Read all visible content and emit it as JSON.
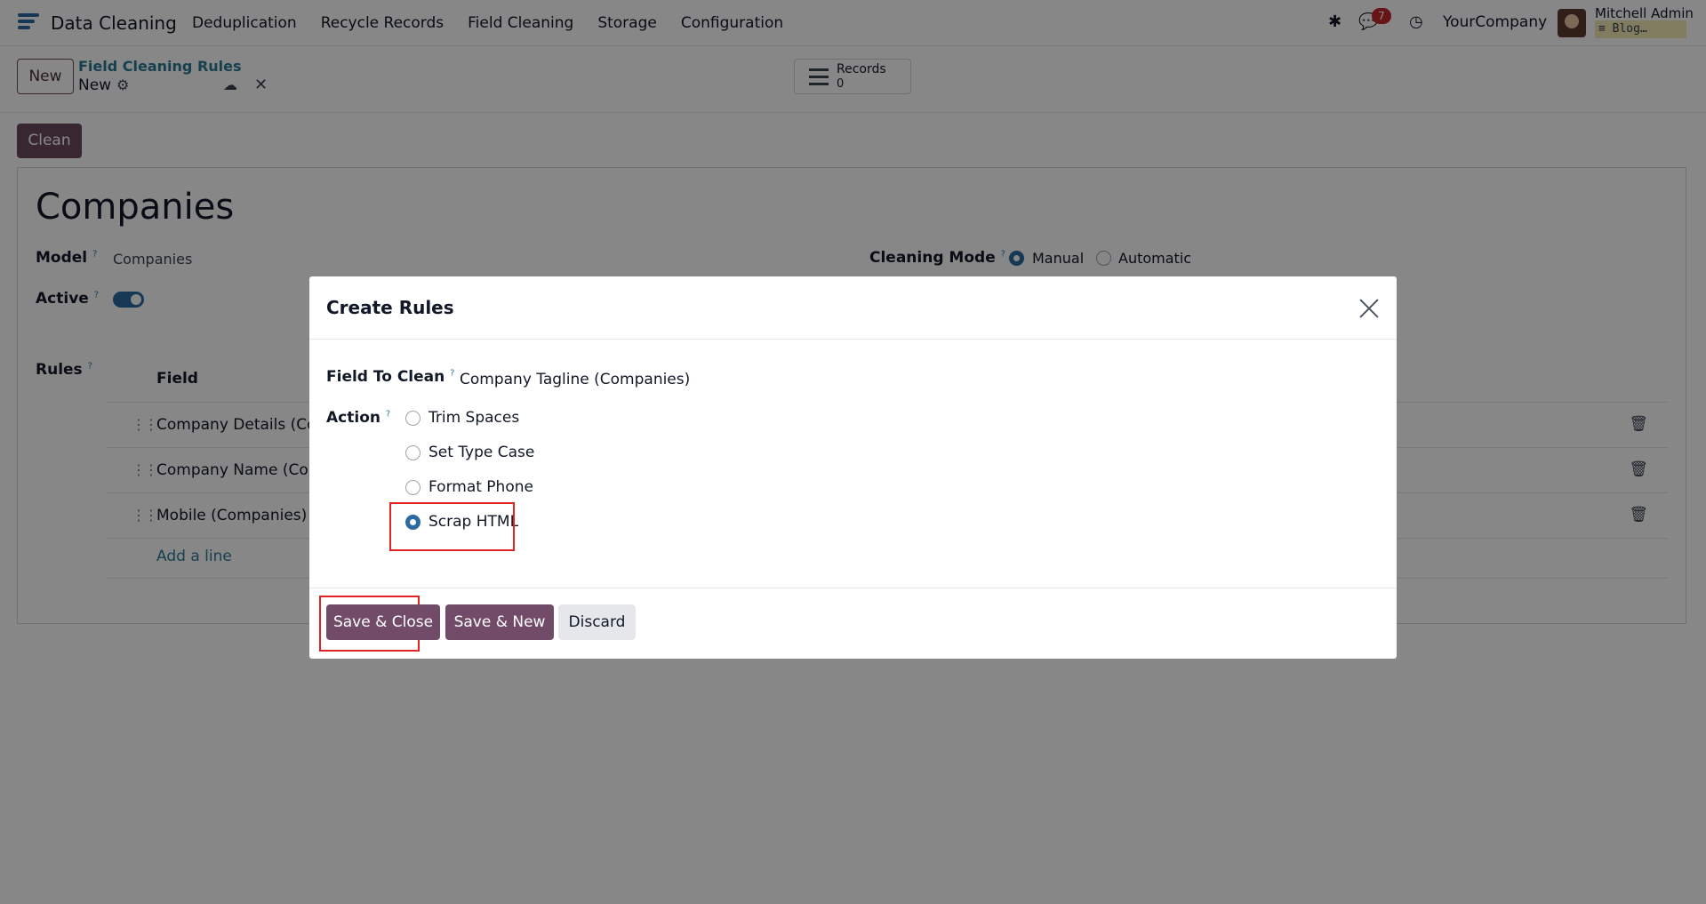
{
  "navbar": {
    "app_name": "Data Cleaning",
    "menu": [
      "Deduplication",
      "Recycle Records",
      "Field Cleaning",
      "Storage",
      "Configuration"
    ],
    "messages_count": "7",
    "company": "YourCompany",
    "user_name": "Mitchell Admin",
    "database": "Blog…"
  },
  "control_panel": {
    "new_label": "New",
    "breadcrumb_parent": "Field Cleaning Rules",
    "breadcrumb_current": "New",
    "records_label": "Records",
    "records_count": "0"
  },
  "form": {
    "clean_label": "Clean",
    "title": "Companies",
    "model_label": "Model",
    "model_value": "Companies",
    "active_label": "Active",
    "active": true,
    "cleaning_mode_label": "Cleaning Mode",
    "cleaning_modes": [
      "Manual",
      "Automatic"
    ],
    "cleaning_mode_selected": "Manual",
    "rules_label": "Rules",
    "rules_column": "Field",
    "rules": [
      "Company Details (Com",
      "Company Name (Comp",
      "Mobile (Companies)"
    ],
    "add_line": "Add a line",
    "help_mark": "?"
  },
  "dialog": {
    "title": "Create Rules",
    "field_label": "Field To Clean",
    "field_value": "Company Tagline (Companies)",
    "action_label": "Action",
    "actions": [
      "Trim Spaces",
      "Set Type Case",
      "Format Phone",
      "Scrap HTML"
    ],
    "action_selected": "Scrap HTML",
    "save_close": "Save & Close",
    "save_new": "Save & New",
    "discard": "Discard"
  },
  "colors": {
    "primary": "#714b67",
    "link": "#2d7a96",
    "highlight": "#e02424",
    "radio_checked": "#2d6a9f"
  }
}
